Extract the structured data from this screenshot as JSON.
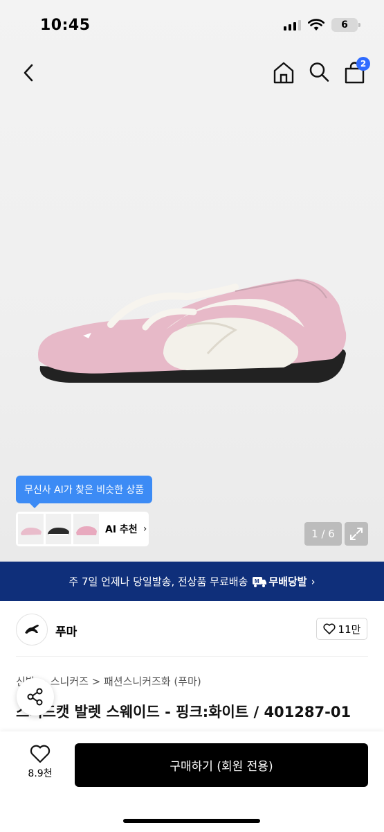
{
  "status_bar": {
    "time": "10:45",
    "battery": "6"
  },
  "nav": {
    "cart_count": "2"
  },
  "gallery": {
    "ai_tooltip": "무신사 AI가 찾은 비슷한 상품",
    "ai_recommend_label": "AI 추천",
    "page_counter": "1 / 6"
  },
  "delivery_banner": {
    "text": "주 7일 언제나 당일발송, 전상품 무료배송",
    "badge": "무배당발"
  },
  "brand": {
    "name": "푸마",
    "likes": "11만"
  },
  "breadcrumb": "신발 > 스니커즈 > 패션스니커즈화 (푸마)",
  "product_title": "스피드캣 발렛 스웨이드 - 핑크:화이트 / 401287-01",
  "bottom_bar": {
    "wish_count": "8.9천",
    "buy_label": "구매하기 (회원 전용)"
  },
  "colors": {
    "accent_blue": "#3c8bf5",
    "banner_navy": "#0f2f7a",
    "badge_blue": "#2f6bff",
    "shoe_pink": "#e6b8c6"
  },
  "icons": [
    "back-icon",
    "home-icon",
    "search-icon",
    "cart-icon",
    "expand-icon",
    "truck-icon",
    "puma-logo",
    "heart-icon",
    "share-icon",
    "chevron-right-icon"
  ]
}
